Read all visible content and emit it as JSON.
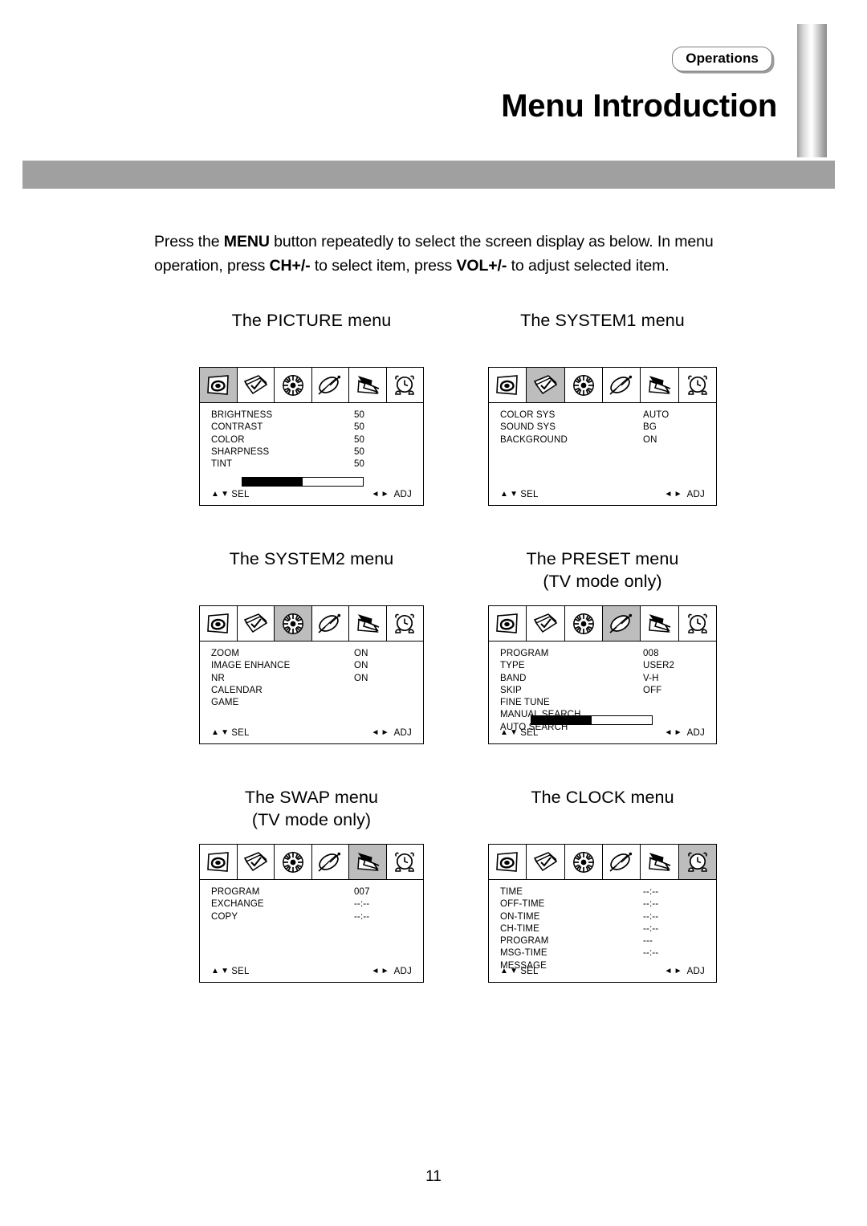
{
  "header": {
    "badge": "Operations",
    "title": "Menu Introduction"
  },
  "intro": {
    "part1": "Press the ",
    "menu_key": "MENU",
    "part2": " button repeatedly to select the screen display as below. In menu operation, press ",
    "ch_key": "CH+/-",
    "part3": " to select item, press ",
    "vol_key": "VOL+/-",
    "part4": " to adjust selected item."
  },
  "icons": [
    "picture-icon",
    "system1-icon",
    "system2-icon",
    "preset-satellite-icon",
    "swap-arrows-icon",
    "clock-alarm-icon"
  ],
  "footer_nav": {
    "up_tri": "▲",
    "down_tri": "▼",
    "sel_label": "SEL",
    "left_tri": "◄",
    "right_tri": "►",
    "adj_label": "ADJ"
  },
  "menus": [
    {
      "caption": "The PICTURE menu",
      "active_icon": 0,
      "rows": [
        {
          "label": "BRIGHTNESS",
          "value": "50"
        },
        {
          "label": "CONTRAST",
          "value": "50"
        },
        {
          "label": "COLOR",
          "value": "50"
        },
        {
          "label": "SHARPNESS",
          "value": "50"
        },
        {
          "label": "TINT",
          "value": "50"
        }
      ],
      "progress": 50
    },
    {
      "caption": "The SYSTEM1 menu",
      "active_icon": 1,
      "rows": [
        {
          "label": "COLOR SYS",
          "value": "AUTO"
        },
        {
          "label": "SOUND SYS",
          "value": "BG"
        },
        {
          "label": "BACKGROUND",
          "value": "ON"
        }
      ],
      "progress": null
    },
    {
      "caption": "The SYSTEM2 menu",
      "active_icon": 2,
      "rows": [
        {
          "label": "ZOOM",
          "value": "ON"
        },
        {
          "label": "IMAGE ENHANCE",
          "value": "ON"
        },
        {
          "label": "NR",
          "value": "ON"
        },
        {
          "label": "CALENDAR",
          "value": ""
        },
        {
          "label": "GAME",
          "value": ""
        }
      ],
      "progress": null
    },
    {
      "caption": "The PRESET menu\n(TV mode only)",
      "active_icon": 3,
      "rows": [
        {
          "label": "PROGRAM",
          "value": "008"
        },
        {
          "label": "TYPE",
          "value": "USER2"
        },
        {
          "label": "BAND",
          "value": "V-H"
        },
        {
          "label": "SKIP",
          "value": "OFF"
        },
        {
          "label": "FINE TUNE",
          "value": ""
        },
        {
          "label": "MANUAL SEARCH",
          "value": ""
        },
        {
          "label": "AUTO SEARCH",
          "value": ""
        }
      ],
      "progress": 50
    },
    {
      "caption": "The SWAP menu\n(TV mode only)",
      "active_icon": 4,
      "rows": [
        {
          "label": "PROGRAM",
          "value": "007"
        },
        {
          "label": "EXCHANGE",
          "value": "--:--"
        },
        {
          "label": "COPY",
          "value": "--:--"
        }
      ],
      "progress": null
    },
    {
      "caption": "The CLOCK menu",
      "active_icon": 5,
      "rows": [
        {
          "label": "TIME",
          "value": "--:--"
        },
        {
          "label": "OFF-TIME",
          "value": "--:--"
        },
        {
          "label": "ON-TIME",
          "value": "--:--"
        },
        {
          "label": "CH-TIME",
          "value": "--:--"
        },
        {
          "label": "PROGRAM",
          "value": "---"
        },
        {
          "label": "MSG-TIME",
          "value": "--:--"
        },
        {
          "label": "MESSAGE",
          "value": ""
        }
      ],
      "progress": null
    }
  ],
  "page_number": "11"
}
